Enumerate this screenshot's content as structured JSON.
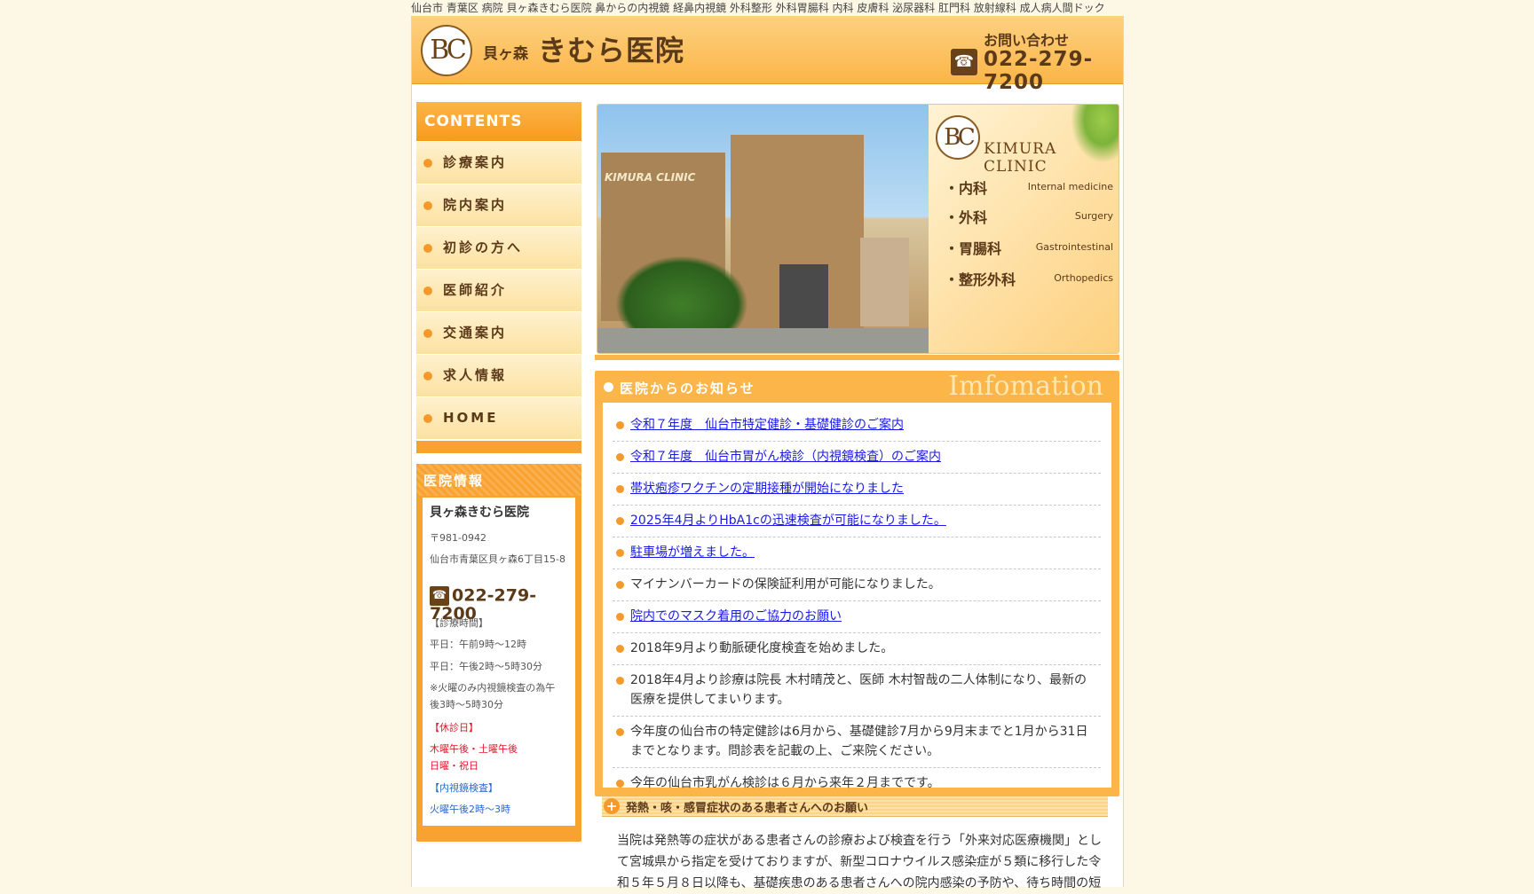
{
  "seo_line": "仙台市 青葉区 病院 貝ヶ森きむら医院 鼻からの内視鏡 経鼻内視鏡 外科整形 外科胃腸科 内科 皮膚科 泌尿器科 肛門科 放射線科 成人病人間ドック",
  "header": {
    "logo_text": "BC",
    "clinic_prefix": "貝ヶ森",
    "clinic_name": "きむら医院",
    "contact_label": "お問い合わせ",
    "phone": "022-279-7200"
  },
  "nav": {
    "heading": "CONTENTS",
    "items": [
      {
        "label": "診療案内"
      },
      {
        "label": "院内案内"
      },
      {
        "label": "初診の方へ"
      },
      {
        "label": "医師紹介"
      },
      {
        "label": "交通案内"
      },
      {
        "label": "求人情報"
      },
      {
        "label": "HOME"
      }
    ]
  },
  "info": {
    "heading": "医院情報",
    "name": "貝ヶ森きむら医院",
    "zip": "〒981-0942",
    "address": "仙台市青葉区貝ヶ森6丁目15-8",
    "phone": "022-279-7200",
    "hours_label": "【診療時間】",
    "hours_am": "平日：午前9時～12時",
    "hours_pm": "平日：午後2時～5時30分",
    "hours_note": "※火曜のみ内視鏡検査の為午後3時～5時30分",
    "closed_label": "【休診日】",
    "closed_1": "木曜午後・土曜午後",
    "closed_2": "日曜・祝日",
    "endo_label": "【内視鏡検査】",
    "endo_time": "火曜午後2時～3時"
  },
  "hero": {
    "building_sign": "KIMURA CLINIC",
    "logo_text": "BC",
    "clinic_en": "KIMURA CLINIC",
    "departments": [
      {
        "jp": "・内科",
        "en": "Internal medicine"
      },
      {
        "jp": "・外科",
        "en": "Surgery"
      },
      {
        "jp": "・胃腸科",
        "en": "Gastrointestinal"
      },
      {
        "jp": "・整形外科",
        "en": "Orthopedics"
      }
    ]
  },
  "news": {
    "heading": "医院からのお知らせ",
    "heading_en": "Imfomation",
    "items": [
      {
        "text": "令和７年度　仙台市特定健診・基礎健診のご案内"
      },
      {
        "text": "令和７年度　仙台市胃がん検診（内視鏡検査）のご案内"
      },
      {
        "text": "帯状疱疹ワクチンの定期接種が開始になりました"
      },
      {
        "text": "2025年4月よりHbA1cの迅速検査が可能になりました。"
      },
      {
        "text": "駐車場が増えました。"
      },
      {
        "text": "マイナンバーカードの保険証利用が可能になりました。"
      },
      {
        "text": "院内でのマスク着用のご協力のお願い"
      },
      {
        "text": "2018年9月より動脈硬化度検査を始めました。"
      },
      {
        "text": "2018年4月より診療は院長 木村晴茂と、医師 木村智哉の二人体制になり、最新の医療を提供してまいります。"
      },
      {
        "text": "今年度の仙台市の特定健診は6月から、基礎健診7月から9月末までと1月から31日までとなります。問診表を記載の上、ご来院ください。"
      },
      {
        "text": "今年の仙台市乳がん検診は６月から来年２月までです。"
      }
    ]
  },
  "notice": {
    "heading": "発熱・咳・感冒症状のある患者さんへのお願い",
    "body": "当院は発熱等の症状がある患者さんの診療および検査を行う「外来対応医療機関」として宮城県から指定を受けておりますが、新型コロナウイルス感染症が５類に移行した令和５年５月８日以降も、基礎疾患のある患者さんへの院内感染の予防や、待ち時間の短"
  }
}
